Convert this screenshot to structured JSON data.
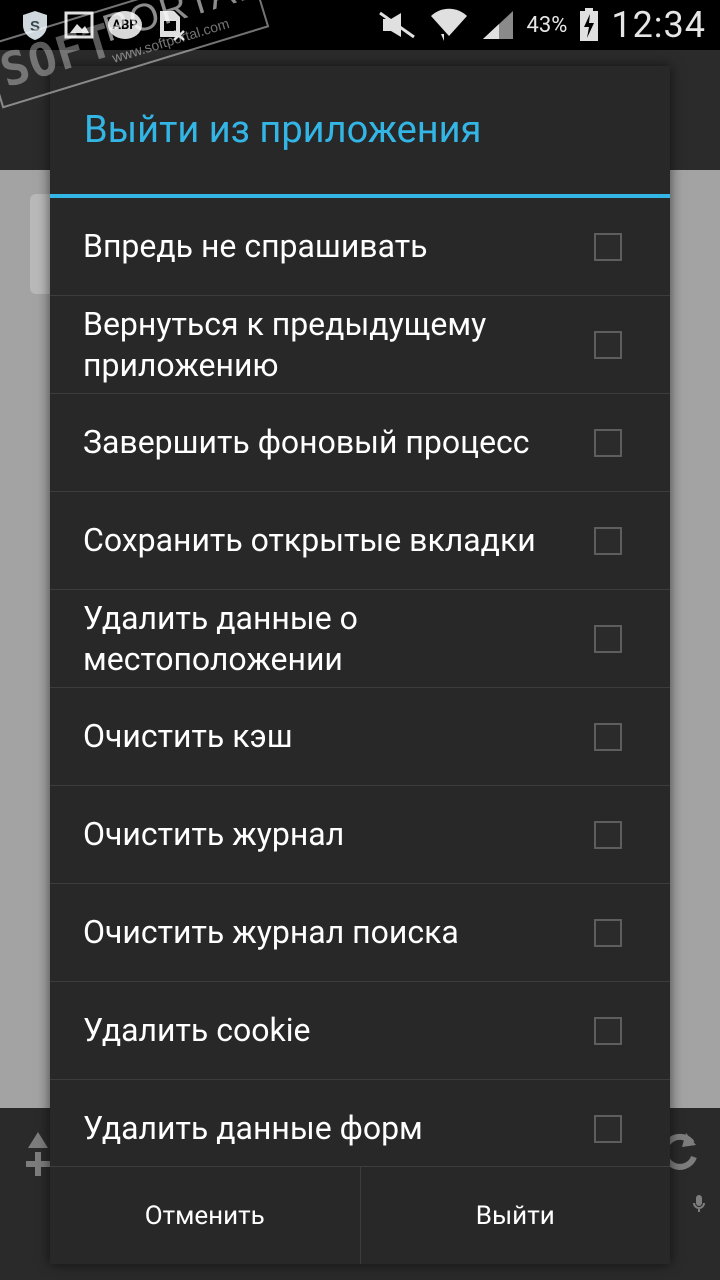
{
  "status_bar": {
    "left_icons": [
      "shield-icon",
      "image-icon",
      "adblock-icon",
      "sim-x-icon"
    ],
    "abp_label": "ABP",
    "right_icons": [
      "mute-icon",
      "wifi-icon",
      "signal-icon",
      "battery-charging-icon"
    ],
    "battery_percent": "43%",
    "time": "12:34"
  },
  "watermark": {
    "brand_prefix": "SOFT",
    "brand": "PORTAL",
    "url": "www.softportal.com",
    "tm": "TM"
  },
  "dialog": {
    "title": "Выйти из приложения",
    "accent_color": "#33b5e5",
    "options": [
      {
        "label": "Впредь не спрашивать",
        "checked": false
      },
      {
        "label": "Вернуться к предыдущему приложению",
        "checked": false
      },
      {
        "label": "Завершить фоновый процесс",
        "checked": false
      },
      {
        "label": "Сохранить открытые вкладки",
        "checked": false
      },
      {
        "label": "Удалить данные о местоположении",
        "checked": false
      },
      {
        "label": "Очистить кэш",
        "checked": false
      },
      {
        "label": "Очистить журнал",
        "checked": false
      },
      {
        "label": "Очистить журнал поиска",
        "checked": false
      },
      {
        "label": "Удалить cookie",
        "checked": false
      },
      {
        "label": "Удалить данные форм",
        "checked": false
      }
    ],
    "cancel_label": "Отменить",
    "exit_label": "Выйти"
  }
}
